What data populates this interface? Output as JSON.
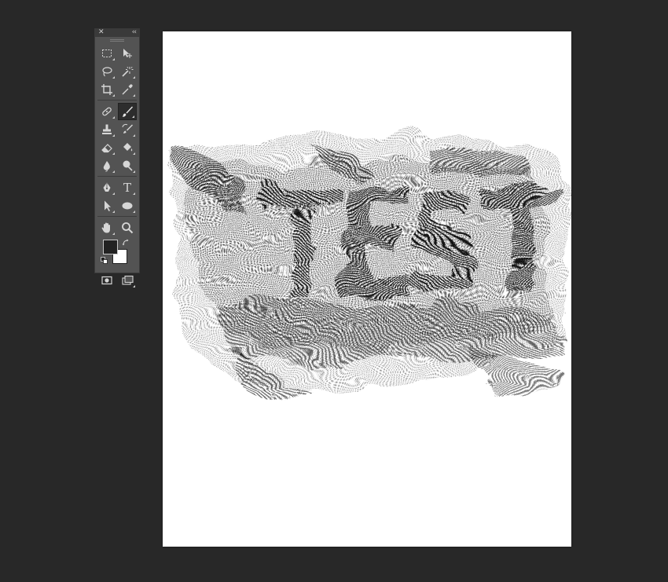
{
  "toolbox": {
    "close_glyph": "✕",
    "collapse_glyph": "‹‹",
    "rows": [
      {
        "left": {
          "name": "rect-marquee-tool",
          "icon": "rectangular-marquee-icon"
        },
        "right": {
          "name": "move-tool",
          "icon": "move-icon"
        }
      },
      {
        "left": {
          "name": "lasso-tool",
          "icon": "lasso-icon"
        },
        "right": {
          "name": "magic-wand-tool",
          "icon": "magic-wand-icon"
        }
      },
      {
        "left": {
          "name": "crop-tool",
          "icon": "crop-icon"
        },
        "right": {
          "name": "eyedropper-tool",
          "icon": "eyedropper-icon"
        }
      },
      {
        "left": {
          "name": "spot-healing-tool",
          "icon": "bandage-icon"
        },
        "right": {
          "name": "brush-tool",
          "icon": "brush-icon",
          "active": true
        }
      },
      {
        "left": {
          "name": "clone-stamp-tool",
          "icon": "stamp-icon"
        },
        "right": {
          "name": "history-brush-tool",
          "icon": "history-brush-icon"
        }
      },
      {
        "left": {
          "name": "eraser-tool",
          "icon": "eraser-icon"
        },
        "right": {
          "name": "paint-bucket-tool",
          "icon": "paint-bucket-icon"
        }
      },
      {
        "left": {
          "name": "blur-tool",
          "icon": "blur-drop-icon"
        },
        "right": {
          "name": "dodge-tool",
          "icon": "dodge-icon"
        }
      },
      {
        "left": {
          "name": "pen-tool",
          "icon": "pen-icon"
        },
        "right": {
          "name": "type-tool",
          "icon": "type-icon"
        }
      },
      {
        "left": {
          "name": "path-selection-tool",
          "icon": "arrow-icon"
        },
        "right": {
          "name": "ellipse-tool",
          "icon": "ellipse-icon"
        }
      },
      {
        "left": {
          "name": "hand-tool",
          "icon": "hand-icon"
        },
        "right": {
          "name": "zoom-tool",
          "icon": "zoom-icon"
        }
      }
    ],
    "type_glyph": "T",
    "foreground_color": "#222222",
    "background_color": "#ffffff"
  },
  "document": {
    "background": "#ffffff",
    "artwork": "halftone-distorted-text"
  }
}
